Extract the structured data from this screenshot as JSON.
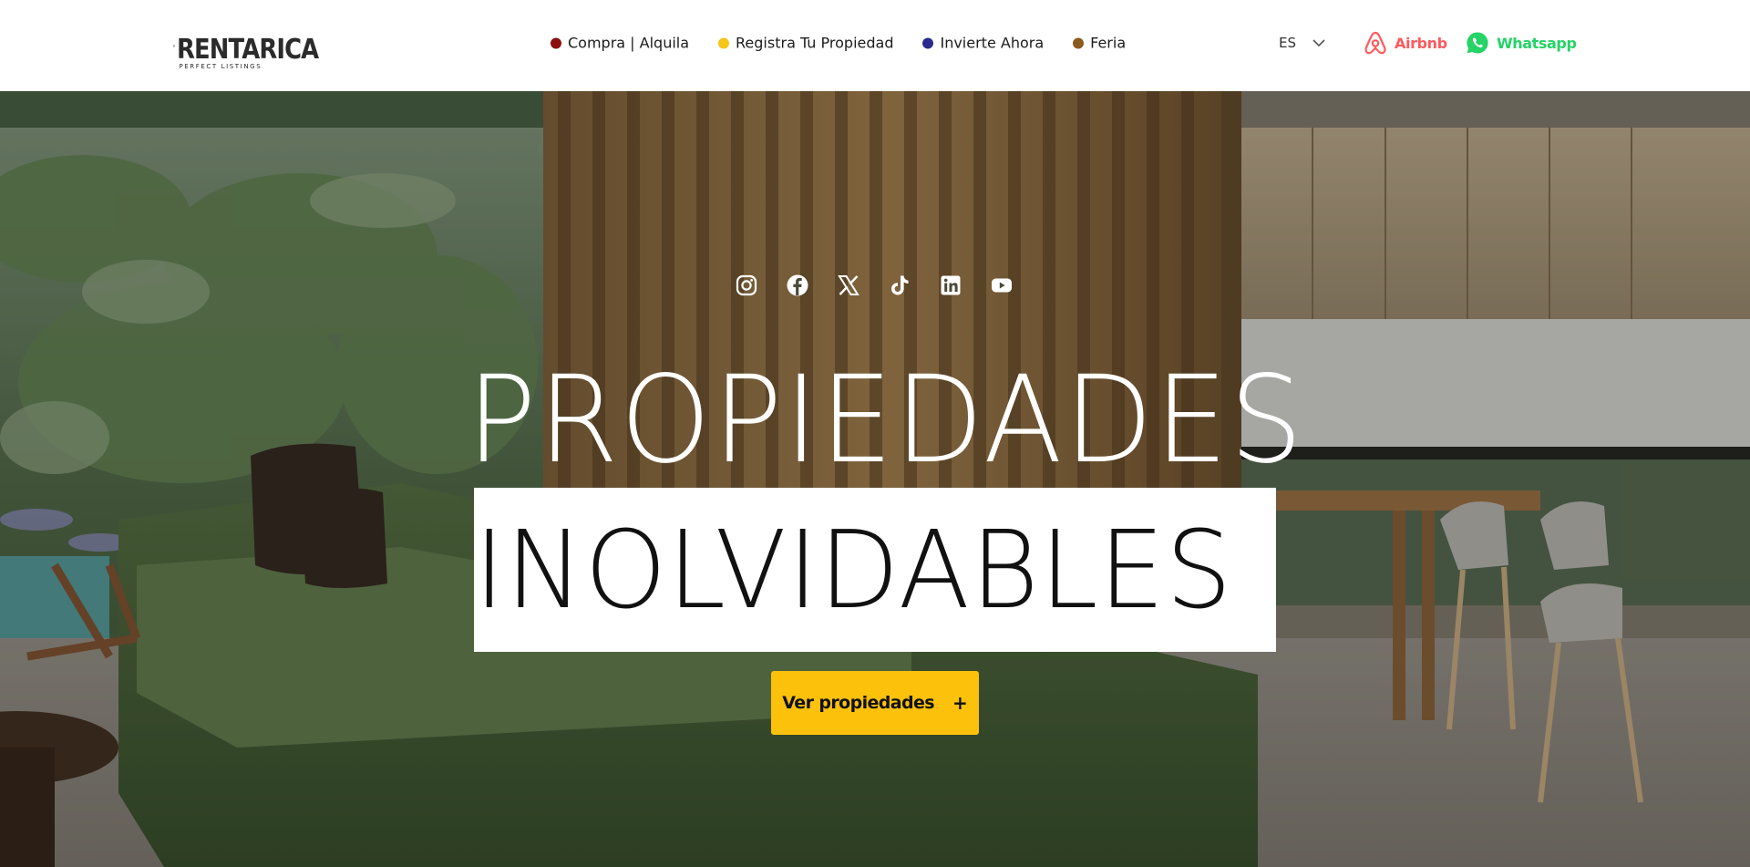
{
  "brand": {
    "name": "RENTARICA",
    "tagline": "PERFECT LISTINGS",
    "logo_color": "#2b2b2b"
  },
  "nav": {
    "items": [
      {
        "label": "Compra | Alquila",
        "dot_color": "#8c1010"
      },
      {
        "label": "Registra Tu Propiedad",
        "dot_color": "#f5c518"
      },
      {
        "label": "Invierte Ahora",
        "dot_color": "#2a2a8c"
      },
      {
        "label": "Feria",
        "dot_color": "#8a5a1f"
      }
    ]
  },
  "language": {
    "selected": "ES",
    "icon": "chevron-down-icon"
  },
  "external_links": {
    "airbnb": {
      "label": "Airbnb",
      "icon": "airbnb-icon",
      "color": "#ff5a5f"
    },
    "whatsapp": {
      "label": "Whatsapp",
      "icon": "whatsapp-icon",
      "color": "#25d366"
    }
  },
  "social": [
    {
      "name": "instagram-icon"
    },
    {
      "name": "facebook-icon"
    },
    {
      "name": "x-icon"
    },
    {
      "name": "tiktok-icon"
    },
    {
      "name": "linkedin-icon"
    },
    {
      "name": "youtube-icon"
    }
  ],
  "hero": {
    "title_line_1": "PROPIEDADES",
    "title_line_2": "INOLVIDABLES",
    "cta_label": "Ver propiedades",
    "cta_icon": "+",
    "cta_color": "#fcc10b"
  }
}
